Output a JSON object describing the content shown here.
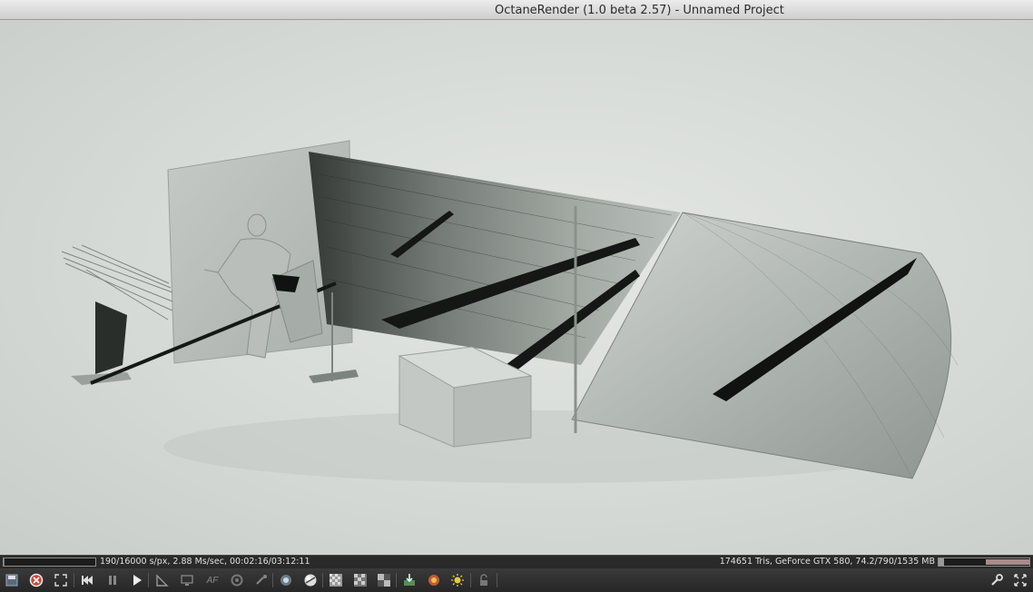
{
  "window": {
    "title": "OctaneRender (1.0 beta 2.57) - Unnamed Project"
  },
  "render": {
    "progress": 0.0119,
    "stats_left": "190/16000 s/px, 2.88 Ms/sec, 00:02:16/03:12:11",
    "stats_right": "174651 Tris, GeForce GTX 580, 74.2/790/1535 MB",
    "memory_used_fraction": 0.06
  },
  "toolbar": {
    "buttons": [
      {
        "icon": "save-image-icon"
      },
      {
        "icon": "reset-render-icon"
      },
      {
        "icon": "fit-view-icon"
      },
      {
        "icon": "restart-icon"
      },
      {
        "icon": "pause-icon"
      },
      {
        "icon": "play-icon"
      },
      {
        "icon": "focus-picker-icon"
      },
      {
        "icon": "display-icon"
      },
      {
        "icon": "autofocus-icon"
      },
      {
        "icon": "white-balance-icon"
      },
      {
        "icon": "material-picker-icon"
      },
      {
        "icon": "lock-camera-icon"
      },
      {
        "icon": "sphere-icon"
      },
      {
        "icon": "checker-small-icon"
      },
      {
        "icon": "checker-medium-icon"
      },
      {
        "icon": "checker-large-icon"
      },
      {
        "icon": "import-icon"
      },
      {
        "icon": "render-region-icon"
      },
      {
        "icon": "sun-icon"
      },
      {
        "icon": "lock-icon"
      },
      {
        "icon": "settings-wrench-icon"
      },
      {
        "icon": "fullscreen-icon"
      }
    ],
    "autofocus_label": "AF"
  }
}
